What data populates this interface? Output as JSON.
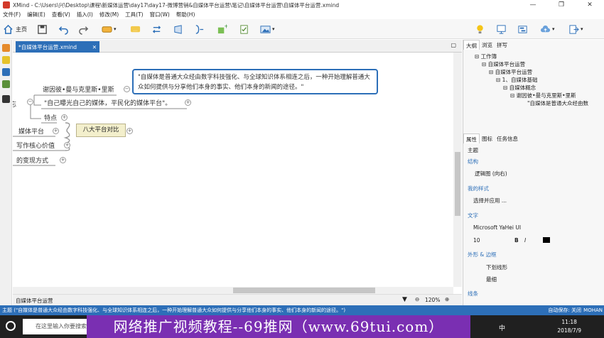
{
  "window": {
    "title": "XMind - C:\\Users\\兴\\Desktop\\课程\\新媒体运营\\day17\\day17-微博营销&自媒体平台运营\\笔记\\自媒体平台运营\\自媒体平台运营.xmind",
    "controls": [
      "—",
      "❐",
      "✕"
    ]
  },
  "menu": [
    "文件(F)",
    "编辑(E)",
    "查看(V)",
    "插入(I)",
    "修改(M)",
    "工具(T)",
    "窗口(W)",
    "帮助(H)"
  ],
  "toolbar": {
    "home_label": "主页"
  },
  "editor": {
    "tab_label": "*自媒体平台运营.xmind",
    "tab_close": "✕",
    "nodes": {
      "person": "谢因彼•曼与克里斯•里斯",
      "quote": "\"自己曝光自己的媒体，平民化的媒体平台\"。",
      "feature": "特点",
      "media_platform": "媒体平台",
      "writing": "写作核心价值",
      "monetize": "的变现方式",
      "summary": "八大平台对比",
      "left_frag": "忘"
    },
    "callout": "\"自媒体是普通大众经由数字科技强化、与全球知识体系相连之后，一种开始理解普通大众如何提供与分享他们本身的事实、他们本身的新闻的途径。\""
  },
  "statusbar": {
    "sheet": "自媒体平台运营",
    "zoom": "120%"
  },
  "right_panel": {
    "top_tabs": [
      "大纲",
      "浏览",
      "拼写"
    ],
    "tree": [
      "⊟ 工作簿",
      "⊟ 自媒体平台运营",
      "⊟ 自媒体平台运营",
      "⊟ 1、自媒体基础",
      "⊟ 自媒体概念",
      "⊟ 谢因彼•曼与克里斯•里斯",
      "\"自媒体是普通大众经由数"
    ],
    "prop_tabs": [
      "属性",
      "图标",
      "任务信息"
    ],
    "section_title": "主题",
    "structure_label": "结构",
    "structure_value": "逻辑图 (向右)",
    "style_label": "我的样式",
    "style_value": "选择并应用 ...",
    "text_label": "文字",
    "font_name": "Microsoft YaHei UI",
    "font_size": "10",
    "shape_label": "外形 & 边框",
    "shape_value": "下划线形",
    "border_value": "最细",
    "line_label": "线条"
  },
  "bottom_status": {
    "text": "主题 (\"自媒体是普通大众经由数字科技强化、与全球知识体系相连之后，一种开始理解普通大众如何提供与分享他们本身的事实、他们本身的新闻的途径。\")",
    "autosave": "自动保存: 关闭",
    "user": "MOHAN"
  },
  "taskbar": {
    "search_placeholder": "在这里输入你要搜索",
    "time": "11:18",
    "date": "2018/7/9",
    "ime": "中"
  },
  "banner": "网络推广视频教程--69推网（www.69tui.com）"
}
